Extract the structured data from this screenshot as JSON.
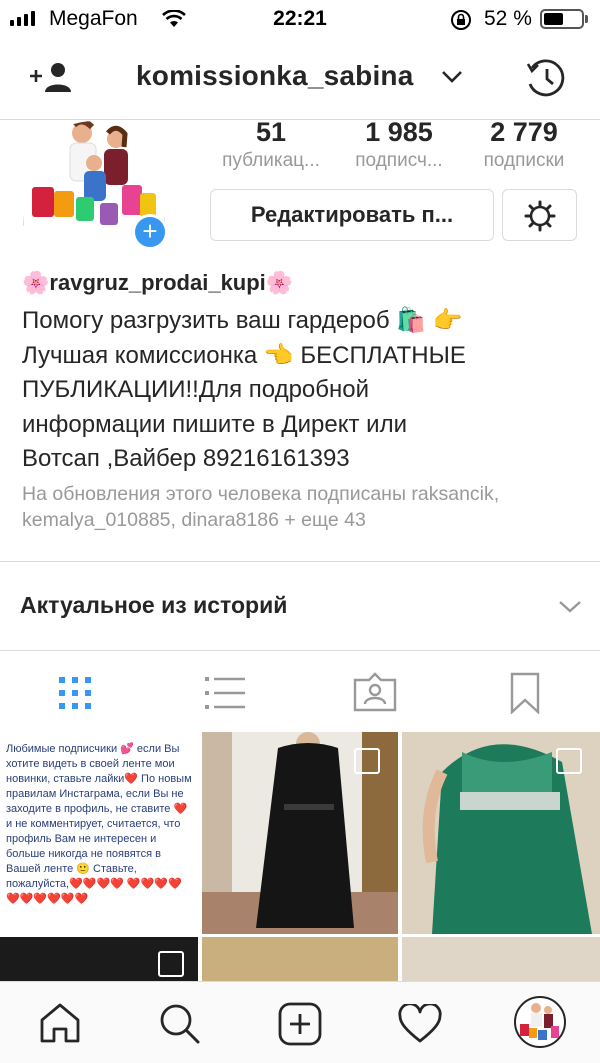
{
  "status_bar": {
    "carrier": "MegaFon",
    "time": "22:21",
    "battery_percent": "52 %",
    "battery_level": 0.52,
    "signal_bars": 4
  },
  "header": {
    "username": "komissionka_sabina",
    "icons": [
      "add-person-icon",
      "chevron-down-icon",
      "history-icon"
    ]
  },
  "profile": {
    "stats": [
      {
        "value": "51",
        "label": "публикац..."
      },
      {
        "value": "1 985",
        "label": "подписч..."
      },
      {
        "value": "2 779",
        "label": "подписки"
      }
    ],
    "edit_label": "Редактировать п...",
    "display_name": "ravgruz_prodai_kupi",
    "name_emoji": "🌸",
    "bio": "Помогу разгрузить ваш гардероб 🛍️ 👉\nЛучшая комиссионка 👈 БЕСПЛАТНЫЕ\nПУБЛИКАЦИИ!!Для подробной\nинформации пишите в Директ или\nВотсап ,Вайбер 89216161393",
    "followed_by": "На обновления этого человека подписаны raksancik, kemalya_010885, dinara8186 + еще 43"
  },
  "highlights": {
    "title": "Актуальное из историй"
  },
  "tabs": [
    "grid-icon",
    "list-icon",
    "tagged-icon",
    "saved-icon"
  ],
  "posts": {
    "note_text": "Любимые подписчики 💕 если Вы хотите видеть в своей ленте мои новинки, ставьте лайки❤️ По новым правилам Инстаграма, если Вы не заходите в профиль, не ставите ❤️ и не комментирует, считается, что профиль Вам не интересен и больше никогда не появятся в Вашей ленте 🙂 Ставьте, пожалуйста,❤️❤️❤️❤️ ❤️❤️❤️❤️❤️❤️❤️❤️❤️❤️"
  },
  "bottom_nav": [
    "home-icon",
    "search-icon",
    "add-post-icon",
    "heart-icon",
    "profile-avatar"
  ],
  "colors": {
    "accent": "#3897f0",
    "text": "#262626",
    "secondary": "#999999",
    "divider": "#dbdbdb"
  }
}
